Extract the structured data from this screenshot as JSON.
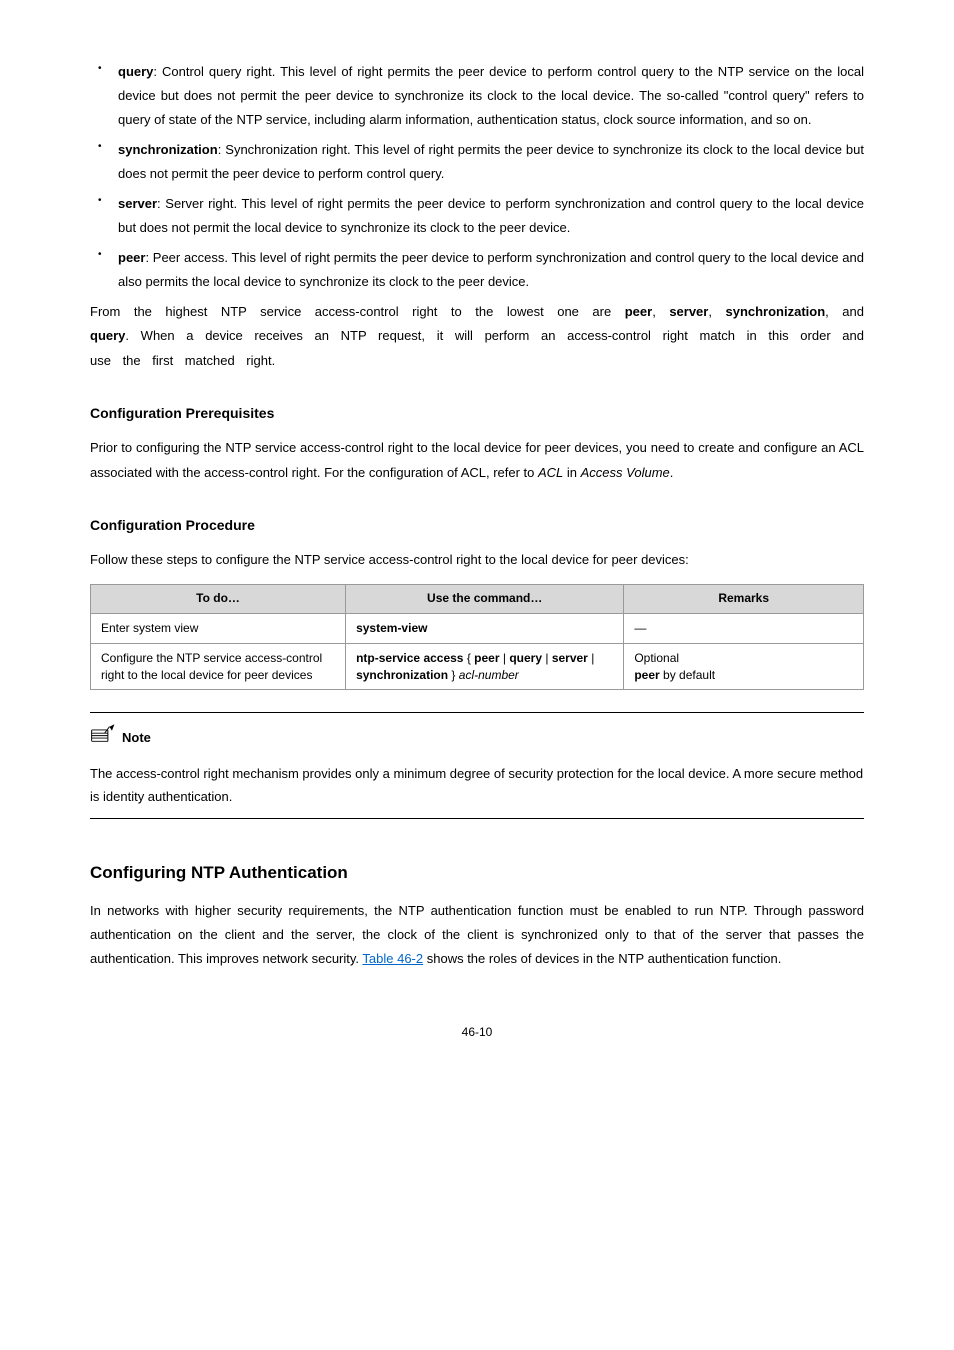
{
  "bullets": [
    {
      "term": "query",
      "text": ": Control query right. This level of right permits the peer device to perform control query to the NTP service on the local device but does not permit the peer device to synchronize its clock to the local device. The so-called \"control query\" refers to query of state of the NTP service, including alarm information, authentication status, clock source information, and so on."
    },
    {
      "term": "synchronization",
      "text": ": Synchronization right. This level of right permits the peer device to synchronize its clock to the local device but does not permit the peer device to perform control query."
    },
    {
      "term": "server",
      "text": ": Server right. This level of right permits the peer device to perform synchronization and control query to the local device but does not permit the local device to synchronize its clock to the peer device."
    },
    {
      "term": "peer",
      "text": ": Peer access. This level of right permits the peer device to perform synchronization and control query to the local device and also permits the local device to synchronize its clock to the peer device."
    }
  ],
  "afterBullets": {
    "pre": "From the highest NTP service access-control right to the lowest one are ",
    "l1": "peer",
    "c1": ", ",
    "l2": "server",
    "c2": ", ",
    "l3": "synchronization",
    "c3": ", and ",
    "l4": "query",
    "tail": ". When a device receives an NTP request, it will perform an access-control right match in this order and use the first matched right."
  },
  "prereqHeading": "Configuration Prerequisites",
  "prereqPara": {
    "p1": "Prior to configuring the NTP service access-control right to the local device for peer devices, you need to create and configure an ACL associated with the access-control right. For the configuration of ACL, refer to ",
    "i1": "ACL",
    "p2": " in ",
    "i2": "Access Volume",
    "p3": "."
  },
  "procHeading": "Configuration Procedure",
  "procIntro": "Follow these steps to configure the NTP service access-control right to the local device for peer devices:",
  "table": {
    "h1": "To do…",
    "h2": "Use the command…",
    "h3": "Remarks",
    "r1c1": "Enter system view",
    "r1c2_b": "system-view",
    "r1c3": "—",
    "r2c1": "Configure the NTP service access-control right to the local device for peer devices",
    "r2c2": {
      "b1": "ntp-service access",
      "t1": " { ",
      "b2": "peer",
      "t2": " | ",
      "b3": "query",
      "t3": " | ",
      "b4": "server",
      "t4": " | ",
      "b5": "synchronization",
      "t5": " } ",
      "i1": "acl-number"
    },
    "r2c3": {
      "l1": "Optional",
      "l2b": "peer",
      "l2t": " by default"
    }
  },
  "noteLabel": "Note",
  "noteBody": "The access-control right mechanism provides only a minimum degree of security protection for the local device. A more secure method is identity authentication.",
  "authHeading": "Configuring NTP Authentication",
  "authPara": {
    "p1": "In networks with higher security requirements, the NTP authentication function must be enabled to run NTP. Through password authentication on the client and the server, the clock of the client is synchronized only to that of the server that passes the authentication. This improves network security. ",
    "link": "Table 46-2",
    "p2": " shows the roles of devices in the NTP authentication function."
  },
  "pageNum": "46-10"
}
